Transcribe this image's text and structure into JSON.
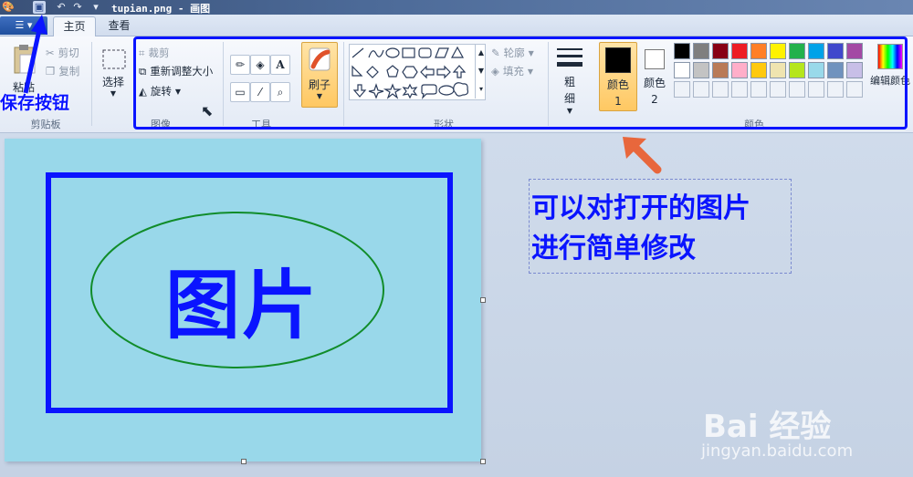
{
  "window": {
    "title": "tupian.png - 画图"
  },
  "tabs": {
    "home": "主页",
    "view": "查看"
  },
  "clipboard": {
    "paste": "粘贴",
    "cut": "剪切",
    "copy": "复制",
    "label": "剪贴板"
  },
  "image_group": {
    "select": "选择",
    "crop": "裁剪",
    "resize": "重新调整大小",
    "rotate": "旋转",
    "label": "图像"
  },
  "tools": {
    "label": "工具"
  },
  "brushes": {
    "label": "刷子"
  },
  "shapes": {
    "outline": "轮廓",
    "fill": "填充",
    "label": "形状"
  },
  "size": {
    "label": "粗细"
  },
  "colors": {
    "color1": "颜色 1",
    "color2": "颜色 2",
    "edit": "编辑颜色",
    "label": "颜色",
    "color1_value": "#000000",
    "color2_value": "#ffffff",
    "palette_row1": [
      "#000000",
      "#7f7f7f",
      "#880015",
      "#ed1c24",
      "#ff7f27",
      "#fff200",
      "#22b14c",
      "#00a2e8",
      "#3f48cc",
      "#a349a4"
    ],
    "palette_row2": [
      "#ffffff",
      "#c3c3c3",
      "#b97a57",
      "#ffaec9",
      "#ffc90e",
      "#efe4b0",
      "#b5e61d",
      "#99d9ea",
      "#7092be",
      "#c8bfe7"
    ]
  },
  "canvas": {
    "text": "图片"
  },
  "annotations": {
    "save": "保存按钮",
    "note_line1": "可以对打开的图片",
    "note_line2": "进行简单修改"
  },
  "watermark": {
    "logo": "Bai 经验",
    "url": "jingyan.baidu.com"
  }
}
